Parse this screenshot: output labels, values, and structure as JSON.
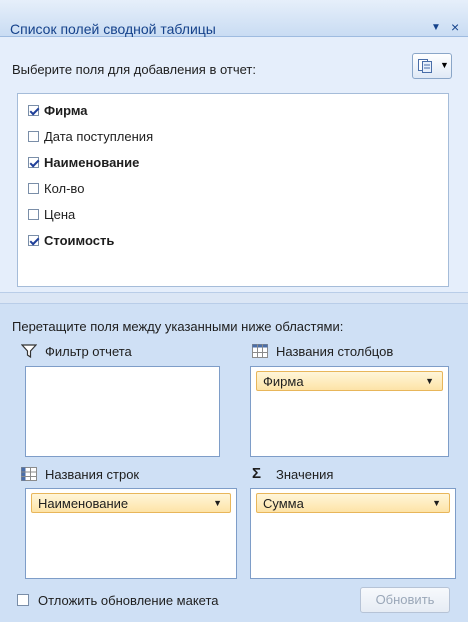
{
  "panel": {
    "title": "Список полей сводной таблицы",
    "title_dropdown_icon": "triangle-down",
    "close_icon": "x"
  },
  "fields": {
    "prompt": "Выберите поля для добавления в отчет:",
    "layout_button_icon": "field-list-layout-icon",
    "items": [
      {
        "label": "Фирма",
        "checked": true
      },
      {
        "label": "Дата поступления",
        "checked": false
      },
      {
        "label": "Наименование",
        "checked": true
      },
      {
        "label": "Кол-во",
        "checked": false
      },
      {
        "label": "Цена",
        "checked": false
      },
      {
        "label": "Стоимость",
        "checked": true
      }
    ]
  },
  "areas": {
    "prompt": "Перетащите поля между указанными ниже областями:",
    "filter": {
      "label": "Фильтр отчета",
      "icon": "filter-funnel-icon",
      "items": []
    },
    "columns": {
      "label": "Названия столбцов",
      "icon": "column-grid-icon",
      "items": [
        "Фирма"
      ]
    },
    "rows": {
      "label": "Названия строк",
      "icon": "row-grid-icon",
      "items": [
        "Наименование"
      ]
    },
    "values": {
      "label": "Значения",
      "icon": "sigma-icon",
      "items": [
        "Сумма"
      ]
    }
  },
  "footer": {
    "defer_label": "Отложить обновление макета",
    "defer_checked": false,
    "update_label": "Обновить"
  },
  "colors": {
    "title_text": "#15428b",
    "panel_bg": "#cfe0f5",
    "chip_fill": "#fde3a7",
    "chip_border": "#e8b65a"
  }
}
